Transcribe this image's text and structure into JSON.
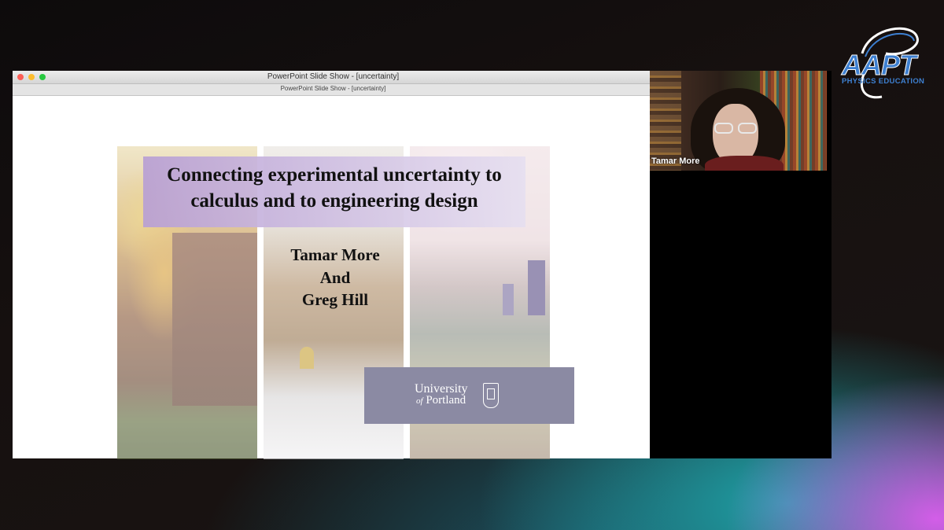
{
  "logo": {
    "brand": "AAPT",
    "tagline": "PHYSICS EDUCATION"
  },
  "window": {
    "title": "PowerPoint Slide Show - [uncertainty]",
    "subtitle": "PowerPoint Slide Show - [uncertainty]"
  },
  "slide": {
    "title": "Connecting experimental uncertainty to calculus and to engineering design",
    "authors": [
      "Tamar More",
      "And",
      "Greg Hill"
    ],
    "university": {
      "line1": "University",
      "of": "of",
      "line2": "Portland"
    }
  },
  "video": {
    "participant_name": "Tamar More"
  }
}
